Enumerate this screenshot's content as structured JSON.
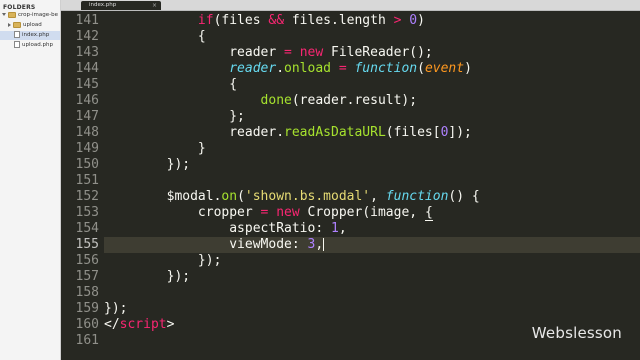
{
  "sidebar": {
    "header": "FOLDERS",
    "items": [
      {
        "label": "crop-image-be",
        "kind": "folder-open"
      },
      {
        "label": "upload",
        "kind": "folder-closed"
      },
      {
        "label": "index.php",
        "kind": "file"
      },
      {
        "label": "upload.php",
        "kind": "file"
      }
    ]
  },
  "tab": {
    "label": "index.php",
    "close": "×"
  },
  "editor": {
    "active_line": 155,
    "lines": [
      {
        "n": "141"
      },
      {
        "n": "142"
      },
      {
        "n": "143"
      },
      {
        "n": "144"
      },
      {
        "n": "145"
      },
      {
        "n": "146"
      },
      {
        "n": "147"
      },
      {
        "n": "148"
      },
      {
        "n": "149"
      },
      {
        "n": "150"
      },
      {
        "n": "151"
      },
      {
        "n": "152"
      },
      {
        "n": "153"
      },
      {
        "n": "154"
      },
      {
        "n": "155"
      },
      {
        "n": "156"
      },
      {
        "n": "157"
      },
      {
        "n": "158"
      },
      {
        "n": "159"
      },
      {
        "n": "160"
      },
      {
        "n": "161"
      }
    ],
    "tokens": {
      "l141": [
        "if",
        "(files ",
        "&&",
        " files.length ",
        ">",
        " ",
        "0",
        ")"
      ],
      "l142": [
        "{"
      ],
      "l143": [
        "reader ",
        "=",
        " ",
        "new",
        " ",
        "FileReader",
        "();"
      ],
      "l144": [
        "reader",
        ".",
        "onload",
        " ",
        "=",
        " ",
        "function",
        "(",
        "event",
        ")"
      ],
      "l145": [
        "{"
      ],
      "l146": [
        "done",
        "(reader.result);"
      ],
      "l147": [
        "};"
      ],
      "l148": [
        "reader.",
        "readAsDataURL",
        "(files[",
        "0",
        "]);"
      ],
      "l149": [
        "}"
      ],
      "l150": [
        "});"
      ],
      "l151": [
        ""
      ],
      "l152": [
        "$modal.",
        "on",
        "(",
        "'shown.bs.modal'",
        ", ",
        "function",
        "() {"
      ],
      "l153": [
        "cropper ",
        "=",
        " ",
        "new",
        " ",
        "Cropper",
        "(image, ",
        "{"
      ],
      "l154": [
        "aspectRatio: ",
        "1",
        ","
      ],
      "l155": [
        "viewMode: ",
        "3",
        ","
      ],
      "l156": [
        "});"
      ],
      "l157": [
        "});"
      ],
      "l158": [
        ""
      ],
      "l159": [
        "});"
      ],
      "l160": [
        "</",
        "script",
        ">"
      ],
      "l161": [
        ""
      ]
    }
  },
  "watermark": "Webslesson",
  "colors": {
    "background": "#272822",
    "keyword": "#f92672",
    "function": "#a6e22e",
    "number": "#ae81ff",
    "string": "#e6db74"
  }
}
